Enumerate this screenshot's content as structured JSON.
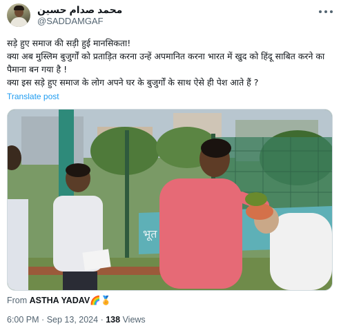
{
  "author": {
    "display_name": "محمد صدام حسین",
    "handle": "@SADDAMGAF"
  },
  "tweet": {
    "lines": [
      "सड़े हुए समाज की सड़ी हुई मानसिकता!",
      "क्या अब मुस्लिम बुजुर्गों को प्रताड़ित करना उन्हें अपमानित करना भारत में खुद को हिंदू साबित करने का पैमाना बन गया है !",
      "क्या इस सड़े हुए समाज के लोग अपने घर के बुजुर्गों के साथ ऐसे ही पेश आते हैं ?"
    ],
    "translate_label": "Translate post"
  },
  "media": {
    "overlay_text": "भूत"
  },
  "source": {
    "prefix": "From",
    "name": "ASTHA YADAV",
    "emoji": "🌈🏅"
  },
  "meta": {
    "time": "6:00 PM",
    "separator": "·",
    "date": "Sep 13, 2024",
    "views_count": "138",
    "views_label": "Views"
  },
  "icons": {
    "more": "more-horizontal-icon"
  }
}
